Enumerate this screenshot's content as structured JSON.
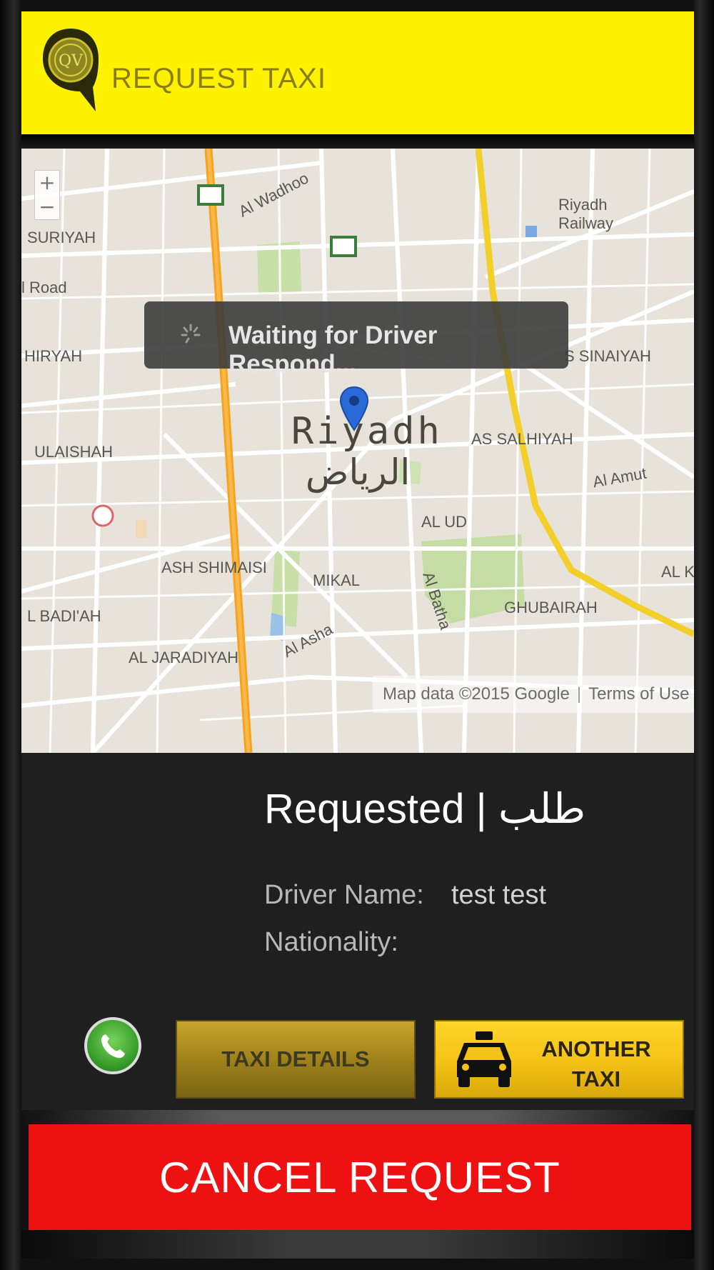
{
  "header": {
    "title": "REQUEST TAXI",
    "logo_icon": "taxi-logo-icon",
    "bg_color": "#fff200"
  },
  "map": {
    "zoom_in": "+",
    "zoom_out": "−",
    "toast": "Waiting for Driver Respond...",
    "city_en": "Riyadh",
    "city_ar": "الرياض",
    "labels": {
      "suriyah": "SURIYAH",
      "al_wadhoo": "Al Wadhoo",
      "riyadh_railway_1": "Riyadh",
      "riyadh_railway_2": "Railway",
      "road": "l Road",
      "shiryah": "HIRYAH",
      "sinaiyah": "S SINAIYAH",
      "ulaishah": "ULAISHAH",
      "as_salhiyah": "AS SALHIYAH",
      "al_amut": "Al Amut",
      "al_ud": "AL UD",
      "ash_shimaisi": "ASH SHIMAISI",
      "mikal": "MIKAL",
      "al_batha": "Al Batha",
      "ghubairah": "GHUBAIRAH",
      "badiah": "L BADI'AH",
      "al_asha": "Al Asha",
      "jaradiyah": "AL JARADIYAH",
      "al_k": "AL K"
    },
    "attribution": "Map data ©2015 Google",
    "terms": "Terms of Use"
  },
  "status": {
    "text": "Requested | طلب"
  },
  "driver": {
    "name_label": "Driver Name:",
    "name_value": "test test",
    "nationality_label": "Nationality:",
    "nationality_value": ""
  },
  "actions": {
    "call_icon": "phone-icon",
    "taxi_details": "TAXI DETAILS",
    "another_taxi_line1": "ANOTHER",
    "another_taxi_line2": "TAXI",
    "cancel": "CANCEL REQUEST"
  },
  "colors": {
    "accent_yellow": "#fff200",
    "cancel_red": "#ee1111",
    "panel_dark": "#1f1f1f"
  }
}
